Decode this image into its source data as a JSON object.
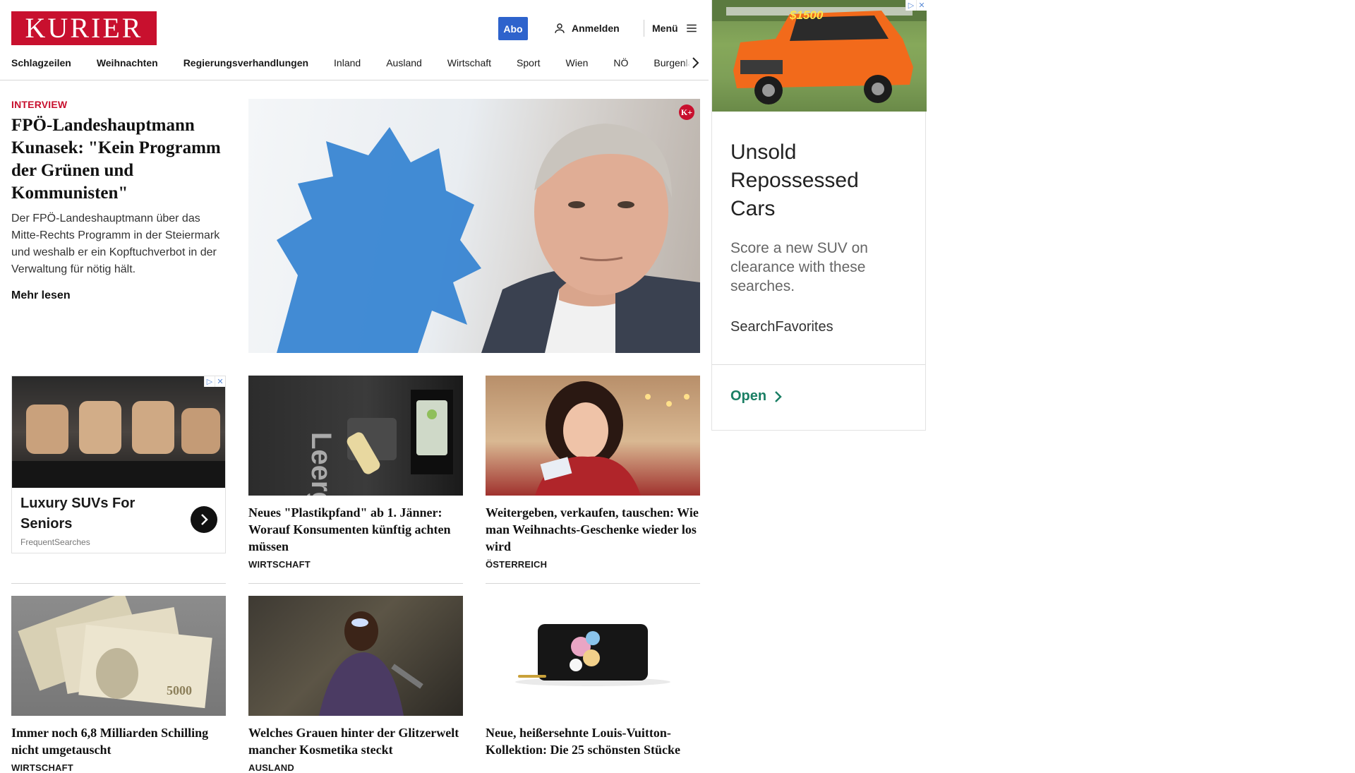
{
  "header": {
    "logo": "KURIER",
    "abo_label": "Abo",
    "login_label": "Anmelden",
    "menu_label": "Menü"
  },
  "nav": {
    "items": [
      "Schlagzeilen",
      "Weihnachten",
      "Regierungsverhandlungen",
      "Inland",
      "Ausland",
      "Wirtschaft",
      "Sport",
      "Wien",
      "NÖ",
      "Burgenland"
    ]
  },
  "hero": {
    "kicker": "INTERVIEW",
    "title": "FPÖ-Landeshauptmann Kunasek: \"Kein Pro­gramm der Grünen und Kommunisten\"",
    "teaser": "Der FPÖ-Landeshauptmann über das Mitte-Rechts Programm in der Steiermark und weshalb er ein Kopftuchverbot in der Verwaltung für nötig hält.",
    "more": "Mehr lesen",
    "badge": "K+"
  },
  "native_ad": {
    "title": "Luxury SUVs For Seniors",
    "source": "FrequentSearches",
    "badge_icons": [
      "ad-choices-icon",
      "close-icon"
    ]
  },
  "articles": [
    {
      "title": "Neues \"Plastikpfand\" ab 1. Jänner: Worauf Konsumenten künftig ach­ten müssen",
      "section": "WIRTSCHAFT"
    },
    {
      "title": "Weitergeben, verkaufen, tauschen: Wie man Weihnachts-Geschenke wieder los wird",
      "section": "ÖSTERREICH"
    },
    {
      "title": "Immer noch 6,8 Milliarden Schil­ling nicht umgetauscht",
      "section": "WIRTSCHAFT"
    },
    {
      "title": "Welches Grauen hinter der Glitzer­welt mancher Kosmetika steckt",
      "section": "AUSLAND"
    },
    {
      "title": "Neue, heißersehnte Louis-Vuitton-Kollektion: Die 25 schönsten Stücke",
      "section": ""
    }
  ],
  "side_ad": {
    "price_tag": "$1500",
    "title": "Unsold Repossessed Cars",
    "text": "Score a new SUV on clearance with these searches.",
    "brand": "SearchFavorites",
    "cta": "Open"
  },
  "colors": {
    "brand_red": "#c8102e",
    "abo_blue": "#2e63cc",
    "cta_green": "#1a7f64"
  }
}
